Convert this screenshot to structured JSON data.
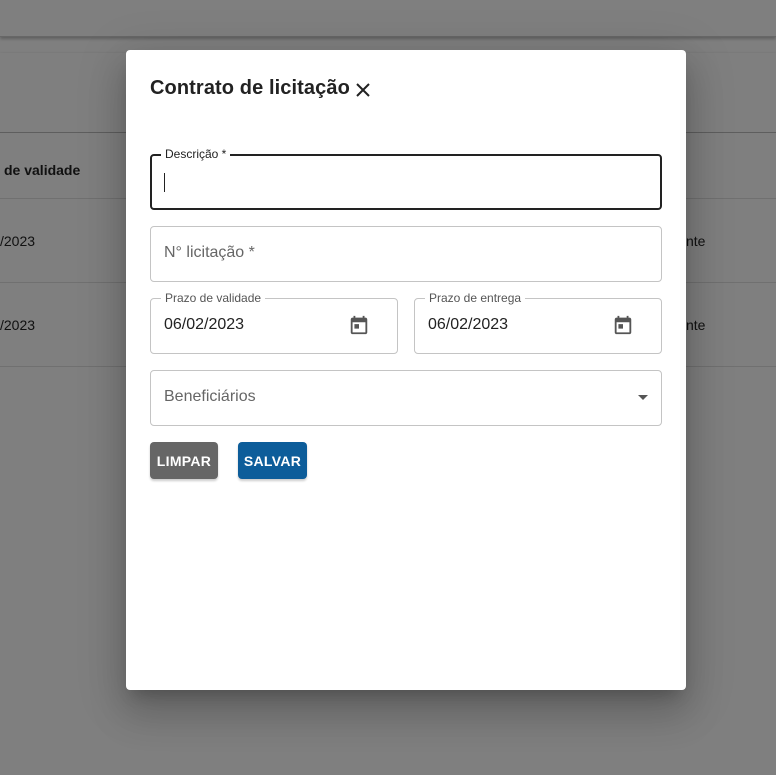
{
  "background": {
    "table_header_partial": "de validade",
    "rows": [
      {
        "date_partial": "/2023",
        "status_partial": "nte"
      },
      {
        "date_partial": "/2023",
        "status_partial": "nte"
      }
    ]
  },
  "dialog": {
    "title": "Contrato de licitação",
    "close_icon": "close-icon",
    "fields": {
      "descricao": {
        "label": "Descrição *",
        "value": ""
      },
      "num_licitacao": {
        "placeholder": "N° licitação *",
        "value": ""
      },
      "prazo_validade": {
        "label": "Prazo de validade",
        "value": "06/02/2023",
        "icon": "calendar-icon"
      },
      "prazo_entrega": {
        "label": "Prazo de entrega",
        "value": "06/02/2023",
        "icon": "calendar-icon"
      },
      "beneficiarios": {
        "placeholder": "Beneficiários",
        "value": "",
        "icon": "dropdown-arrow-icon"
      }
    },
    "buttons": {
      "clear_label": "LIMPAR",
      "save_label": "SALVAR"
    },
    "colors": {
      "clear_button": "#666666",
      "save_button": "#0d5d9a"
    }
  }
}
